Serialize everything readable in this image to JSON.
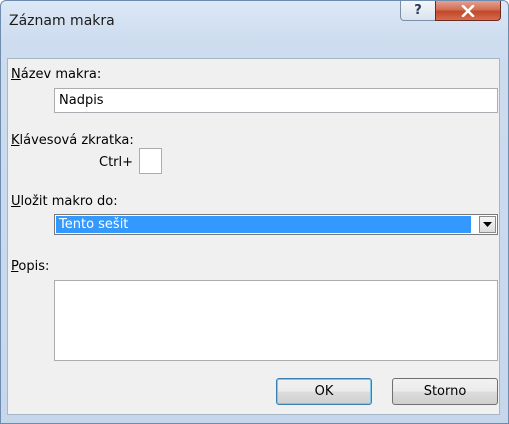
{
  "window": {
    "title": "Záznam makra"
  },
  "titlebar_buttons": {
    "help_glyph": "?",
    "help_icon": "help-icon",
    "close_icon": "close-icon"
  },
  "macro_name": {
    "label_acc": "N",
    "label_rest": "ázev makra:",
    "value": "Nadpis"
  },
  "shortcut": {
    "label_acc": "K",
    "label_rest": "lávesová zkratka:",
    "prefix": "Ctrl+",
    "value": ""
  },
  "store_in": {
    "label_acc": "U",
    "label_rest": "ložit makro do:",
    "selected": "Tento sešit"
  },
  "description": {
    "label_acc": "P",
    "label_rest": "opis:",
    "value": ""
  },
  "buttons": {
    "ok": "OK",
    "cancel": "Storno"
  },
  "colors": {
    "selection": "#3399ff",
    "close_button": "#c2482a",
    "default_button_border": "#3c7fb1"
  }
}
